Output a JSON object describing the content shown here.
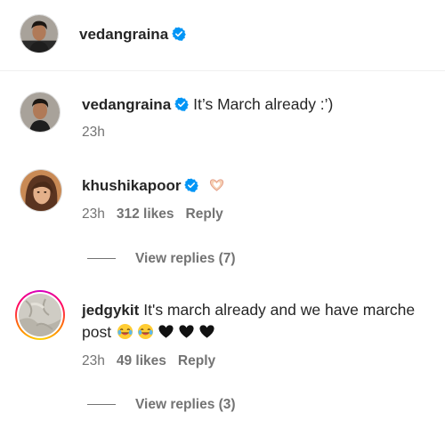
{
  "post_header": {
    "username": "vedangraina",
    "verified": true
  },
  "caption": {
    "username": "vedangraina",
    "verified": true,
    "text": "It’s March already :’)",
    "time": "23h"
  },
  "comments": [
    {
      "username": "khushikapoor",
      "verified": true,
      "emoji": "heart-hands-emoji",
      "time": "23h",
      "likes": "312 likes",
      "reply_label": "Reply",
      "view_replies": "View replies (7)"
    },
    {
      "username": "jedgykit",
      "verified": false,
      "text_line1": "It's march already and we have marche",
      "text_line2": "post",
      "emojis": [
        "laughing-emoji",
        "laughing-emoji",
        "black-heart-emoji",
        "black-heart-emoji",
        "black-heart-emoji"
      ],
      "time": "23h",
      "likes": "49 likes",
      "reply_label": "Reply",
      "view_replies": "View replies (3)"
    }
  ],
  "colors": {
    "verified_blue": "#0095f6",
    "meta_gray": "#737373",
    "divider": "#efefef"
  }
}
